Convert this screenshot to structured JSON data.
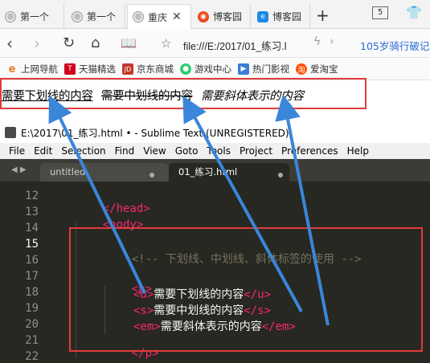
{
  "browser": {
    "tabs": [
      {
        "label": "第一个",
        "active": false
      },
      {
        "label": "第一个",
        "active": false
      },
      {
        "label": "重庆",
        "active": true
      },
      {
        "label": "博客园",
        "active": false
      },
      {
        "label": "博客园",
        "active": false
      }
    ],
    "tab_count": "5",
    "new_tab": "+",
    "url": "file:///E:/2017/01_练习.l",
    "promo": "105岁骑行破记",
    "bookmarks": [
      {
        "label": "上网导航",
        "icon": "e-icon",
        "color": "#e67e22"
      },
      {
        "label": "天猫精选",
        "icon": "tmall-icon",
        "color": "#d0021b"
      },
      {
        "label": "京东商城",
        "icon": "jd-icon",
        "color": "#c0392b"
      },
      {
        "label": "游戏中心",
        "icon": "game-icon",
        "color": "#2ecc71"
      },
      {
        "label": "热门影视",
        "icon": "video-icon",
        "color": "#3b7dd8"
      },
      {
        "label": "爱淘宝",
        "icon": "taobao-icon",
        "color": "#ff5000"
      }
    ]
  },
  "result": {
    "underline_text": "需要下划线的内容",
    "strike_text": "需要中划线的内容",
    "italic_text": "需要斜体表示的内容"
  },
  "sublime": {
    "title": "E:\\2017\\01_练习.html • - Sublime Text (UNREGISTERED)",
    "menu": [
      "File",
      "Edit",
      "Selection",
      "Find",
      "View",
      "Goto",
      "Tools",
      "Project",
      "Preferences",
      "Help"
    ],
    "tabs": [
      {
        "label": "untitled",
        "active": false
      },
      {
        "label": "01_练习.html",
        "active": true
      }
    ],
    "lines": [
      {
        "num": "12",
        "current": false
      },
      {
        "num": "13",
        "current": false
      },
      {
        "num": "14",
        "current": false
      },
      {
        "num": "15",
        "current": true
      },
      {
        "num": "16",
        "current": false
      },
      {
        "num": "17",
        "current": false
      },
      {
        "num": "18",
        "current": false
      },
      {
        "num": "19",
        "current": false
      },
      {
        "num": "20",
        "current": false
      },
      {
        "num": "21",
        "current": false
      },
      {
        "num": "22",
        "current": false
      }
    ],
    "code": {
      "l12_tag": "</head>",
      "l13_tag": "<body>",
      "l15_comment": "<!-- 下划线、中划线、斜体标签的使用 -->",
      "l17_tag": "<p>",
      "l18_open": "<u>",
      "l18_text": "需要下划线的内容",
      "l18_close": "</u>",
      "l19_open": "<s>",
      "l19_text": "需要中划线的内容",
      "l19_close": "</s>",
      "l20_open": "<em>",
      "l20_text": "需要斜体表示的内容",
      "l20_close": "</em>",
      "l21_tag": "</p>"
    }
  },
  "colors": {
    "highlight_box": "#e23b3b",
    "arrow": "#3a86d9",
    "editor_bg": "#272822",
    "tag": "#f92672",
    "comment": "#75715e"
  }
}
